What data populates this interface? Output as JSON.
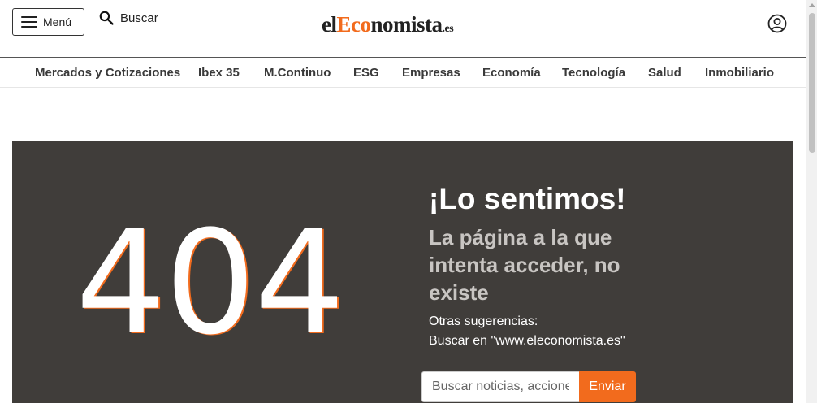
{
  "header": {
    "menu_label": "Menú",
    "search_label": "Buscar",
    "logo": {
      "part1": "el",
      "accent": "Eco",
      "part2": "nomista",
      "tld": ".es"
    },
    "icons": {
      "menu": "hamburger-icon",
      "search": "search-icon",
      "user": "user-account-icon"
    }
  },
  "nav": {
    "items": [
      {
        "label": "Mercados y Cotizaciones"
      },
      {
        "label": "Ibex 35"
      },
      {
        "label": "M.Continuo"
      },
      {
        "label": "ESG"
      },
      {
        "label": "Empresas"
      },
      {
        "label": "Economía"
      },
      {
        "label": "Tecnología"
      },
      {
        "label": "Salud"
      },
      {
        "label": "Inmobiliario"
      }
    ]
  },
  "error": {
    "code": "404",
    "title": "¡Lo sentimos!",
    "message": "La página a la que intenta acceder, no existe",
    "suggestions_title": "Otras sugerencias:",
    "suggestion_link": "Buscar en \"www.eleconomista.es\"",
    "search_placeholder": "Buscar noticias, acciones...",
    "submit_label": "Enviar"
  },
  "colors": {
    "accent": "#f26b1d",
    "hero_background": "#403d3a",
    "subtitle": "#c8c5c2"
  }
}
